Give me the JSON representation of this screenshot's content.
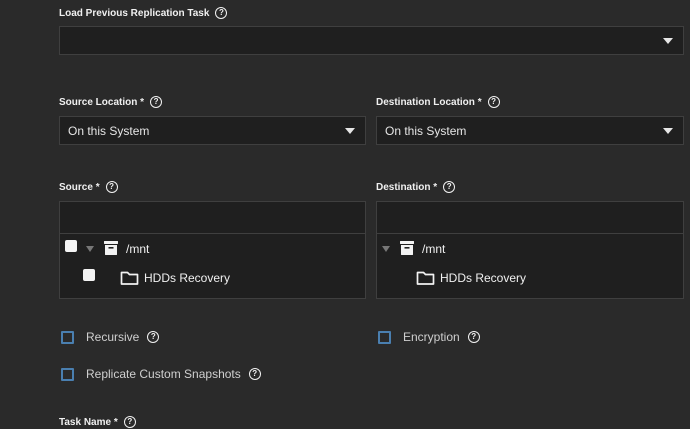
{
  "load_task": {
    "label": "Load Previous Replication Task",
    "value": ""
  },
  "source_location": {
    "label": "Source Location",
    "required": "*",
    "value": "On this System"
  },
  "destination_location": {
    "label": "Destination Location",
    "required": "*",
    "value": "On this System"
  },
  "source": {
    "label": "Source",
    "required": "*",
    "input_value": "",
    "tree": [
      {
        "name": "/mnt",
        "icon": "archive-icon"
      },
      {
        "name": "HDDs Recovery",
        "icon": "folder-icon"
      }
    ]
  },
  "destination": {
    "label": "Destination",
    "required": "*",
    "input_value": "",
    "tree": [
      {
        "name": "/mnt",
        "icon": "archive-icon"
      },
      {
        "name": "HDDs Recovery",
        "icon": "folder-icon"
      }
    ]
  },
  "options": {
    "recursive": "Recursive",
    "encryption": "Encryption",
    "replicate_custom_snapshots": "Replicate Custom Snapshots"
  },
  "task_name": {
    "label": "Task Name",
    "required": "*"
  },
  "help_glyph": "?",
  "colors": {
    "background": "#2a2a2a",
    "field": "#1f1f1f",
    "checkbox_border": "#4a7fb0"
  }
}
